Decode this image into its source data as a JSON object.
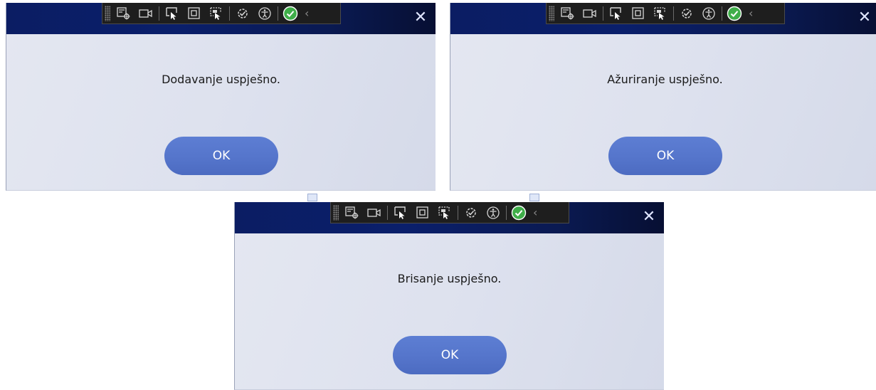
{
  "dialogs": [
    {
      "message": "Dodavanje uspješno.",
      "ok_label": "OK",
      "close_glyph": "✕"
    },
    {
      "message": "Ažuriranje uspješno.",
      "ok_label": "OK",
      "close_glyph": "✕"
    },
    {
      "message": "Brisanje uspješno.",
      "ok_label": "OK",
      "close_glyph": "✕"
    }
  ],
  "toolbar": {
    "icons": [
      "live-visual-tree-icon",
      "record-icon",
      "select-element-icon",
      "display-layout-adorners-icon",
      "track-focused-element-icon",
      "hot-reload-icon",
      "accessibility-checker-icon",
      "hot-reload-status-ok-icon",
      "collapse-chevron-icon"
    ],
    "collapse_glyph": "‹"
  },
  "colors": {
    "titlebar": "#0b1d63",
    "ok_button": "#5575cb",
    "dialog_body": "#dde1ee",
    "toolbar_bg": "#1e1e1e",
    "status_ok": "#3fae49"
  }
}
